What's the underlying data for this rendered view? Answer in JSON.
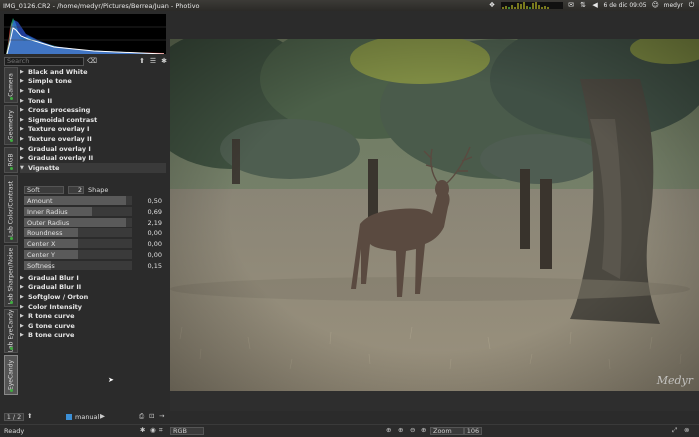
{
  "window": {
    "title": "IMG_0126.CR2 - /home/medyr/Pictures/Berrea/Juan - Photivo",
    "tray": {
      "clock": "6 de dic 09:05",
      "user": "medyr",
      "icons": [
        "dropbox-icon",
        "system-monitor-icon",
        "mail-icon",
        "network-icon",
        "volume-icon",
        "user-icon",
        "power-icon"
      ]
    }
  },
  "left_panel": {
    "search_placeholder": "Search",
    "tabs": [
      "Camera",
      "Geometry",
      "RGB",
      "Lab Color/Contrast",
      "Lab Sharpen/Noise",
      "Lab EyeCandy",
      "EyeCandy"
    ],
    "active_tab": "EyeCandy",
    "tools_before": [
      "Black and White",
      "Simple tone",
      "Tone I",
      "Tone II",
      "Cross processing",
      "Sigmoidal contrast",
      "Texture overlay I",
      "Texture overlay II",
      "Gradual overlay I",
      "Gradual overlay II"
    ],
    "open_tool": "Vignette",
    "vignette": {
      "mode_value": "Soft",
      "shape_value": "2",
      "shape_label": "Shape",
      "sliders": [
        {
          "label": "Amount",
          "value": "0,50",
          "fraction": 0.94
        },
        {
          "label": "Inner Radius",
          "value": "0,69",
          "fraction": 0.63
        },
        {
          "label": "Outer Radius",
          "value": "2,19",
          "fraction": 0.94
        },
        {
          "label": "Roundness",
          "value": "0,00",
          "fraction": 0.5
        },
        {
          "label": "Center X",
          "value": "0,00",
          "fraction": 0.5
        },
        {
          "label": "Center Y",
          "value": "0,00",
          "fraction": 0.5
        },
        {
          "label": "Softness",
          "value": "0,15",
          "fraction": 0.25
        }
      ]
    },
    "tools_after": [
      "Gradual Blur I",
      "Gradual Blur II",
      "Softglow / Orton",
      "Color Intensity",
      "R tone curve",
      "G tone curve",
      "B tone curve"
    ]
  },
  "image": {
    "watermark": "Medyr"
  },
  "bottom": {
    "page_indicator": "1 / 2",
    "preset_label": "manual",
    "status": "Ready",
    "channel": "RGB",
    "zoom_label": "Zoom",
    "zoom_value": "106",
    "accent": "#3b8fd6"
  }
}
